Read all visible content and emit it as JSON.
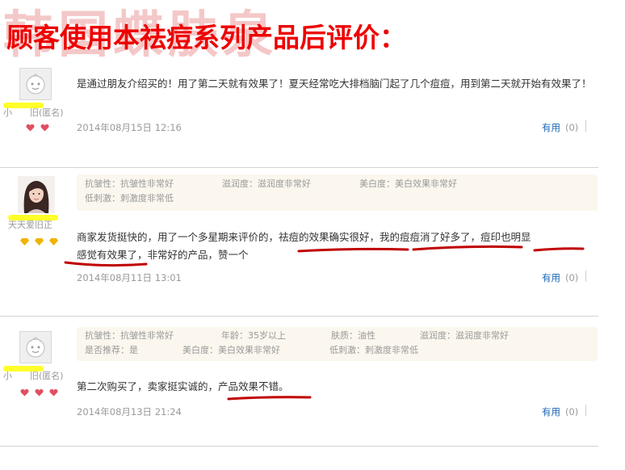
{
  "watermark": "韩国蝶肤泉",
  "title": "顾客使用本祛痘系列产品后评价：",
  "colors": {
    "title": "#ee0000",
    "watermark": "#f4c8c8",
    "link": "#1a66b3",
    "underline": "#c00000",
    "highlight": "#ffff2a",
    "tag_bg": "#fbf7ee"
  },
  "reviews": [
    {
      "username": "小  旧(匿名)",
      "avatar": "default-avatar-icon",
      "level_icon": "heart-icon",
      "level_count": 2,
      "tags": [],
      "text": "是通过朋友介绍买的！用了第二天就有效果了！夏天经常吃大排档脑门起了几个痘痘，用到第二天就开始有效果了！",
      "date": "2014年08月15日 12:16",
      "useful_label": "有用",
      "useful_count": "(0)"
    },
    {
      "username": "天天爱旧正",
      "avatar": "user-photo",
      "level_icon": "diamond-icon",
      "level_count": 3,
      "tags": [
        [
          "抗皱性：抗皱性非常好",
          "滋润度：滋润度非常好",
          "美白度：美白效果非常好"
        ],
        [
          "低刺激：刺激度非常低"
        ]
      ],
      "text_parts": [
        "商家发货挺快的，用了一个多星期来评价的，",
        "祛痘的效果确实很好，",
        "我的痘痘消了好多了，",
        "痘印也明显",
        "感觉有效果了",
        "，非常好的产品，赞一个"
      ],
      "date": "2014年08月11日 13:01",
      "useful_label": "有用",
      "useful_count": "(0)"
    },
    {
      "username": "小  旧(匿名)",
      "avatar": "default-avatar-icon",
      "level_icon": "heart-icon",
      "level_count": 3,
      "tags": [
        [
          "抗皱性：抗皱性非常好",
          "年龄：35岁以上",
          "肤质：油性",
          "滋润度：滋润度非常好"
        ],
        [
          "是否推荐：是",
          "美白度：美白效果非常好",
          "低刺激：刺激度非常低"
        ]
      ],
      "text_parts": [
        "第二次购买了，卖家挺实诚的，",
        "产品效果不错。"
      ],
      "date": "2014年08月13日 21:24",
      "useful_label": "有用",
      "useful_count": "(0)"
    }
  ]
}
